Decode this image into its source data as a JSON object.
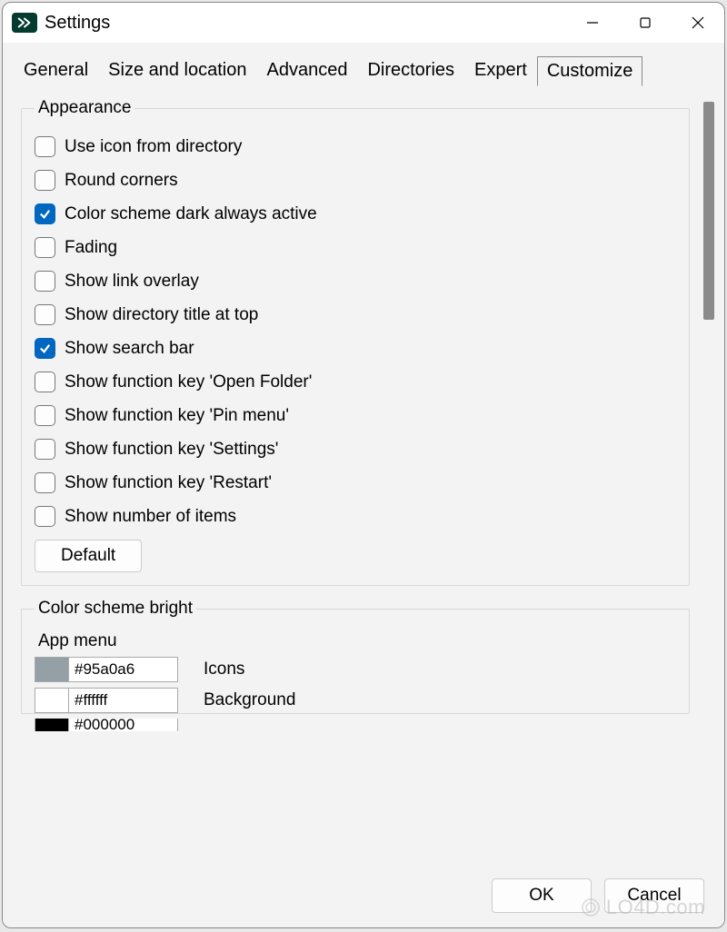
{
  "window": {
    "title": "Settings"
  },
  "tabs": [
    {
      "label": "General"
    },
    {
      "label": "Size and location"
    },
    {
      "label": "Advanced"
    },
    {
      "label": "Directories"
    },
    {
      "label": "Expert"
    },
    {
      "label": "Customize",
      "active": true
    }
  ],
  "appearance": {
    "legend": "Appearance",
    "options": [
      {
        "label": "Use icon from directory",
        "checked": false
      },
      {
        "label": "Round corners",
        "checked": false
      },
      {
        "label": "Color scheme dark always active",
        "checked": true
      },
      {
        "label": "Fading",
        "checked": false
      },
      {
        "label": "Show link overlay",
        "checked": false
      },
      {
        "label": "Show directory title at top",
        "checked": false
      },
      {
        "label": "Show search bar",
        "checked": true
      },
      {
        "label": "Show function key 'Open Folder'",
        "checked": false
      },
      {
        "label": "Show function key 'Pin menu'",
        "checked": false
      },
      {
        "label": "Show function key 'Settings'",
        "checked": false
      },
      {
        "label": "Show function key 'Restart'",
        "checked": false
      },
      {
        "label": "Show number of items",
        "checked": false
      }
    ],
    "default_button": "Default"
  },
  "color_scheme": {
    "legend": "Color scheme bright",
    "section_label": "App menu",
    "rows": [
      {
        "swatch": "#95a0a6",
        "hex": "#95a0a6",
        "label": "Icons"
      },
      {
        "swatch": "#ffffff",
        "hex": "#ffffff",
        "label": "Background"
      },
      {
        "swatch": "#000000",
        "hex": "#000000",
        "label": ""
      }
    ]
  },
  "footer": {
    "ok": "OK",
    "cancel": "Cancel"
  },
  "watermark": "LO4D.com"
}
